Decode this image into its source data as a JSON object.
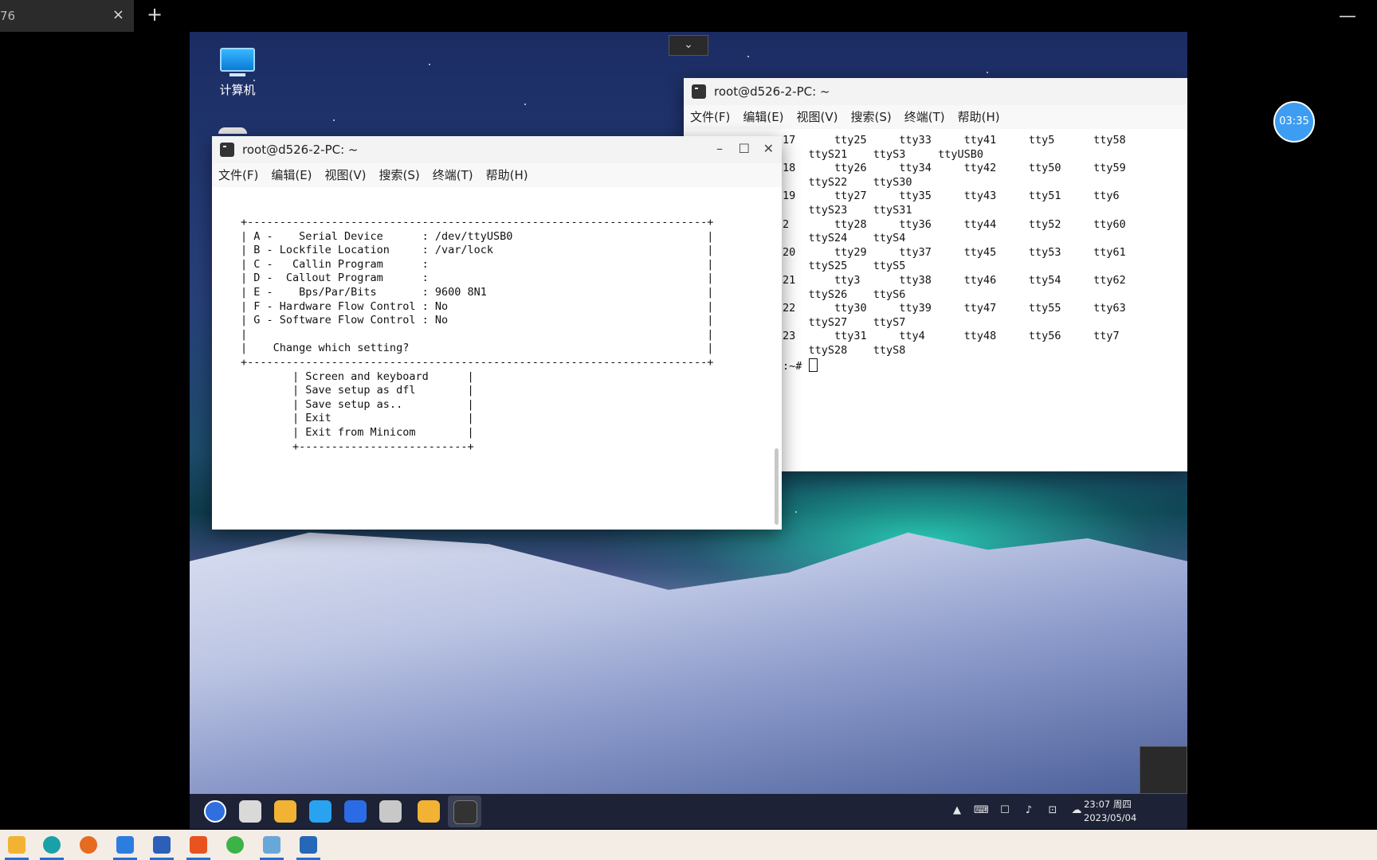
{
  "host": {
    "tab_title": "76",
    "tab_close": "×",
    "new_tab": "+",
    "minimize": "—"
  },
  "desktop": {
    "computer_icon_label": "计算机",
    "dropdown_glyph": "⌄"
  },
  "terminal_front": {
    "title": "root@d526-2-PC: ~",
    "controls": {
      "min": "–",
      "max": "☐",
      "close": "✕"
    },
    "menu": [
      "文件(F)",
      "编辑(E)",
      "视图(V)",
      "搜索(S)",
      "终端(T)",
      "帮助(H)"
    ],
    "screen_lines": [
      "+-----------------------------------------------------------------------+",
      "| A -    Serial Device      : /dev/ttyUSB0                              |",
      "| B - Lockfile Location     : /var/lock                                 |",
      "| C -   Callin Program      :                                           |",
      "| D -  Callout Program      :                                           |",
      "| E -    Bps/Par/Bits       : 9600 8N1                                  |",
      "| F - Hardware Flow Control : No                                        |",
      "| G - Software Flow Control : No                                        |",
      "|                                                                       |",
      "|    Change which setting?                                              |",
      "+-----------------------------------------------------------------------+",
      "        | Screen and keyboard      |",
      "        | Save setup as dfl        |",
      "        | Save setup as..          |",
      "        | Exit                     |",
      "        | Exit from Minicom        |",
      "        +--------------------------+"
    ]
  },
  "terminal_back": {
    "title": "root@d526-2-PC: ~",
    "menu": [
      "文件(F)",
      "编辑(E)",
      "视图(V)",
      "搜索(S)",
      "终端(T)",
      "帮助(H)"
    ],
    "screen_lines": [
      "17      tty25     tty33     tty41     tty5      tty58",
      "    ttyS21    ttyS3     ttyUSB0",
      "18      tty26     tty34     tty42     tty50     tty59",
      "    ttyS22    ttyS30",
      "19      tty27     tty35     tty43     tty51     tty6",
      "    ttyS23    ttyS31",
      "2       tty28     tty36     tty44     tty52     tty60",
      "    ttyS24    ttyS4",
      "20      tty29     tty37     tty45     tty53     tty61",
      "    ttyS25    ttyS5",
      "21      tty3      tty38     tty46     tty54     tty62",
      "    ttyS26    ttyS6",
      "22      tty30     tty39     tty47     tty55     tty63",
      "    ttyS27    ttyS7",
      "23      tty31     tty4      tty48     tty56     tty7",
      "    ttyS28    ttyS8"
    ],
    "prompt": ":~# "
  },
  "remote_taskbar": {
    "clock_time": "23:07 周四",
    "clock_date": "2023/05/04",
    "apps": [
      "launcher-icon",
      "multitask-icon",
      "file-manager-icon",
      "app-store-icon",
      "wps-writer-icon",
      "screenshot-icon",
      "folder-icon",
      "terminal-icon"
    ]
  },
  "timer": {
    "label": "03:35"
  },
  "host_taskbar": {
    "apps": [
      "file-explorer-icon",
      "edge-icon",
      "firefox-icon",
      "notes-icon",
      "word-icon",
      "remote-app-icon",
      "wechat-icon",
      "remote-desktop-icon",
      "photos-icon"
    ]
  }
}
